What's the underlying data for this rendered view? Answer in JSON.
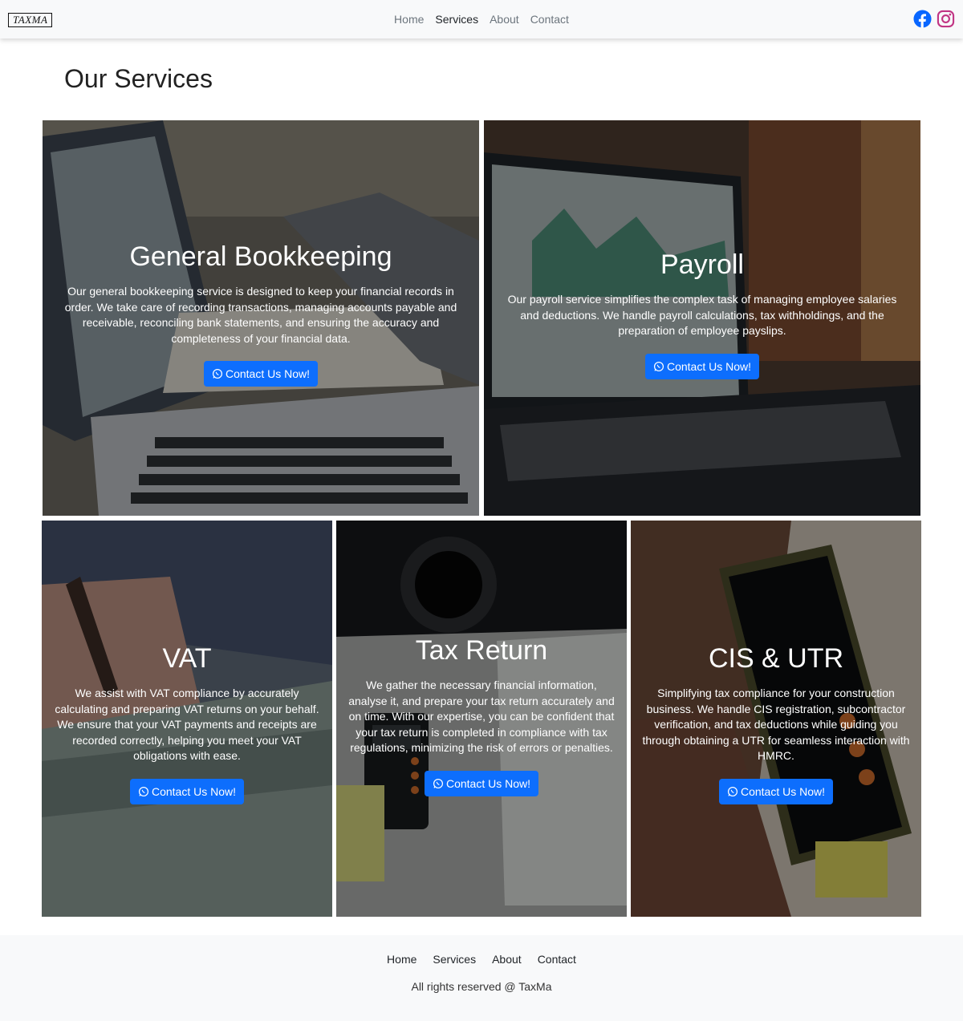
{
  "brand": {
    "logo_text": "TAXMA"
  },
  "nav": {
    "items": [
      {
        "label": "Home"
      },
      {
        "label": "Services"
      },
      {
        "label": "About"
      },
      {
        "label": "Contact"
      }
    ],
    "active": "Services"
  },
  "social": {
    "icons": [
      "facebook-icon",
      "instagram-icon"
    ],
    "facebook_color": "#0866ff",
    "instagram_color": "#c13584"
  },
  "page": {
    "title": "Our Services"
  },
  "services": [
    {
      "title": "General Bookkeeping",
      "text": "Our general bookkeeping service is designed to keep your financial records in order. We take care of recording transactions, managing accounts payable and receivable, reconciling bank statements, and ensuring the accuracy and completeness of your financial data.",
      "button": "Contact Us Now!"
    },
    {
      "title": "Payroll",
      "text": "Our payroll service simplifies the complex task of managing employee salaries and deductions. We handle payroll calculations, tax withholdings, and the preparation of employee payslips.",
      "button": "Contact Us Now!"
    },
    {
      "title": "VAT",
      "text": "We assist with VAT compliance by accurately calculating and preparing VAT returns on your behalf. We ensure that your VAT payments and receipts are recorded correctly, helping you meet your VAT obligations with ease.",
      "button": "Contact Us Now!"
    },
    {
      "title": "Tax Return",
      "text": "We gather the necessary financial information, analyse it, and prepare your tax return accurately and on time. With our expertise, you can be confident that your tax return is completed in compliance with tax regulations, minimizing the risk of errors or penalties.",
      "button": "Contact Us Now!"
    },
    {
      "title": "CIS & UTR",
      "text": "Simplifying tax compliance for your construction business. We handle CIS registration, subcontractor verification, and tax deductions while guiding you through obtaining a UTR for seamless interaction with HMRC.",
      "button": "Contact Us Now!"
    }
  ],
  "colors": {
    "accent": "#0d6efd",
    "navbar_bg": "#f8f9fa",
    "footer_bg": "#f8f9fa"
  },
  "footer": {
    "links": [
      {
        "label": "Home"
      },
      {
        "label": "Services"
      },
      {
        "label": "About"
      },
      {
        "label": "Contact"
      }
    ],
    "copyright": "All rights reserved @ TaxMa"
  }
}
